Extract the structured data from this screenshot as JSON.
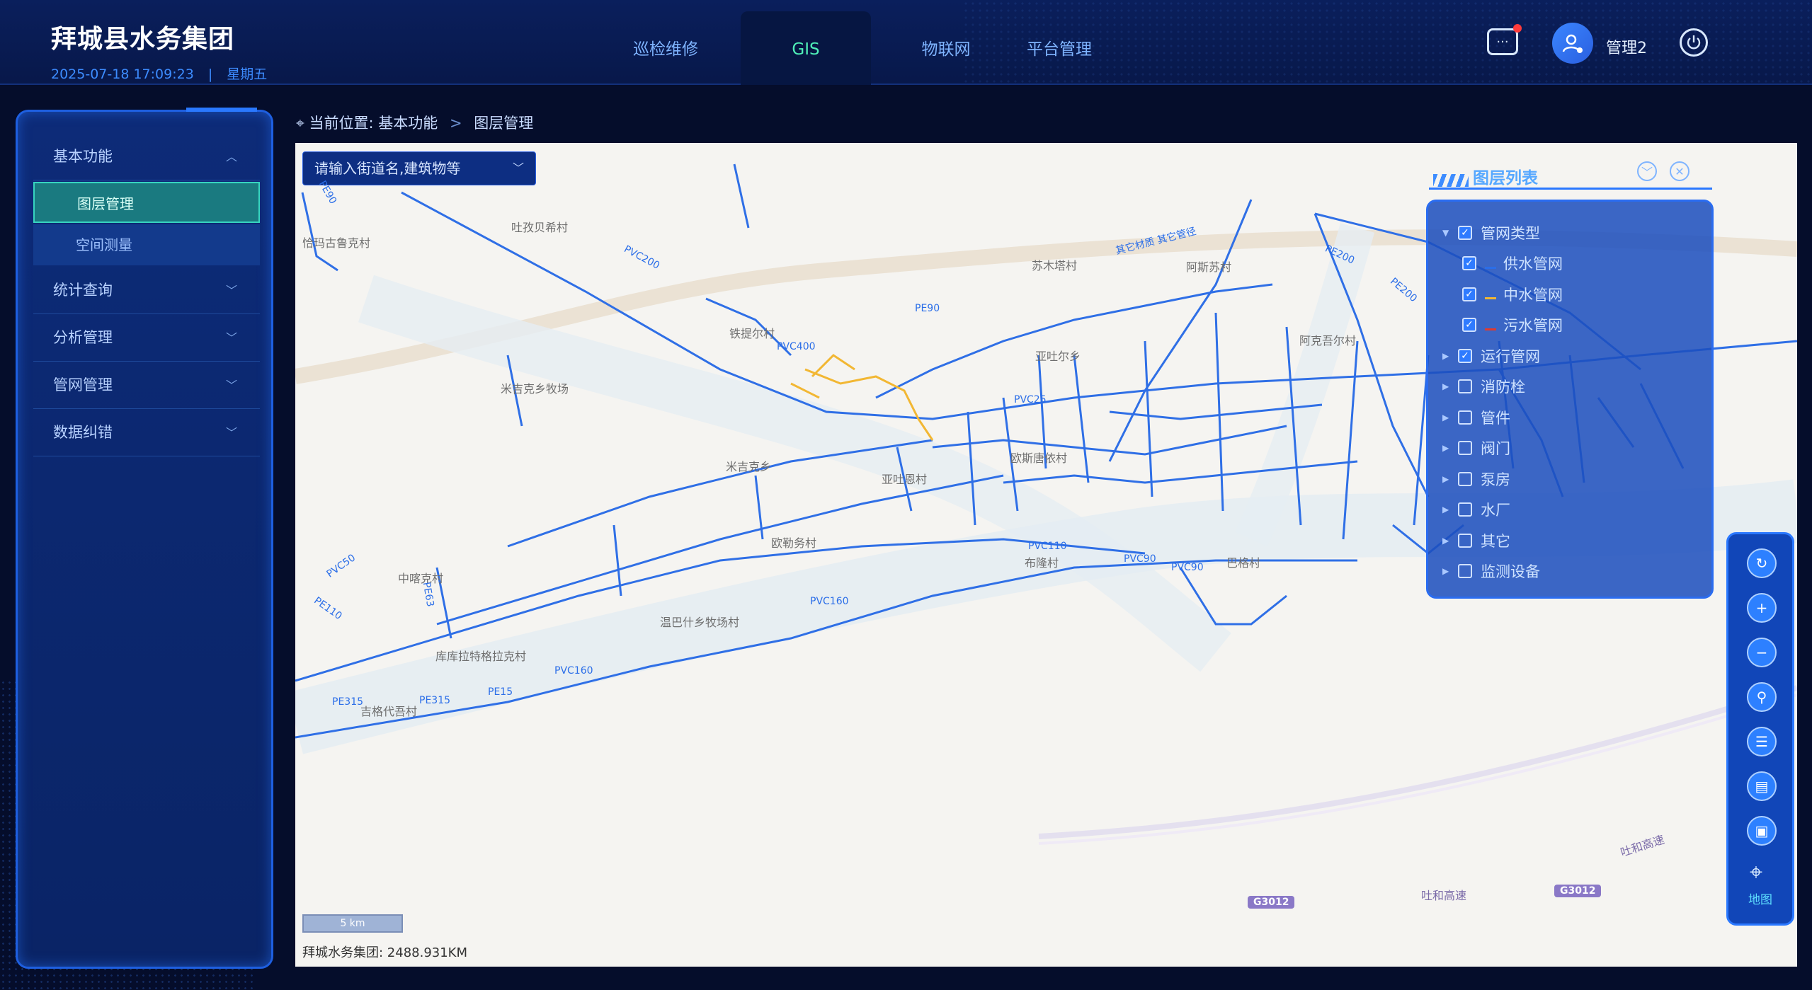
{
  "header": {
    "title": "拜城县水务集团",
    "datetime": "2025-07-18 17:09:23",
    "separator": "|",
    "weekday": "星期五",
    "nav": [
      "巡检维修",
      "GIS",
      "物联网",
      "平台管理"
    ],
    "active_nav": "GIS",
    "message_icon": "chat-bubble-icon",
    "username": "管理2",
    "power_icon": "power-icon"
  },
  "sidebar": {
    "menu": [
      {
        "label": "基本功能",
        "expanded": true,
        "children": [
          "图层管理",
          "空间测量"
        ],
        "active_child": "图层管理"
      },
      {
        "label": "统计查询",
        "expanded": false
      },
      {
        "label": "分析管理",
        "expanded": false
      },
      {
        "label": "管网管理",
        "expanded": false
      },
      {
        "label": "数据纠错",
        "expanded": false
      }
    ]
  },
  "breadcrumb": {
    "prefix": "当前位置:",
    "items": [
      "基本功能",
      "图层管理"
    ]
  },
  "map": {
    "search_placeholder": "请输入街道名,建筑物等",
    "labels": {
      "place_1": "恰玛古鲁克村",
      "place_2": "吐孜贝希村",
      "place_3": "铁提尔村",
      "place_4": "米吉克乡牧场",
      "place_5": "米吉克乡",
      "place_6": "亚吐恩村",
      "place_7": "欧勒务村",
      "place_8": "中喀克村",
      "place_9": "温巴什乡牧场村",
      "place_10": "库库拉特格拉克村",
      "place_11": "吉格代吾村",
      "place_12": "亚吐尔乡",
      "place_13": "欧斯唐依村",
      "place_14": "巴格村",
      "place_15": "阿克吾尔村",
      "place_16": "阿斯苏村",
      "place_17": "布隆村",
      "place_18": "苏木塔村",
      "road_1": "吐和高速",
      "road_2": "吐和高速",
      "shield_1": "G3012",
      "shield_2": "G3012",
      "pipe_1": "PE90",
      "pipe_2": "PVC200",
      "pipe_3": "PE90",
      "pipe_4": "PE200",
      "pipe_5": "PE200",
      "pipe_6": "其它材质 其它管径",
      "pipe_7": "PVC400",
      "pipe_8": "PVC25",
      "pipe_9": "PVC110",
      "pipe_10": "PVC90",
      "pipe_11": "PVC90",
      "pipe_12": "PVC160",
      "pipe_13": "PVC160",
      "pipe_14": "PVC50",
      "pipe_15": "PE110",
      "pipe_16": "PE63",
      "pipe_17": "PE315",
      "pipe_18": "PE315",
      "pipe_19": "PE15"
    },
    "scale_label": "5 km",
    "total_length": "拜城水务集团: 2488.931KM"
  },
  "layer_panel": {
    "title": "图层列表",
    "layers": [
      {
        "label": "管网类型",
        "checked": true,
        "expanded": true,
        "children": [
          {
            "label": "供水管网",
            "checked": true,
            "color": "#2b6ee8"
          },
          {
            "label": "中水管网",
            "checked": true,
            "color": "#f2b733"
          },
          {
            "label": "污水管网",
            "checked": true,
            "color": "#e03a2f"
          }
        ]
      },
      {
        "label": "运行管网",
        "checked": true
      },
      {
        "label": "消防栓",
        "checked": false
      },
      {
        "label": "管件",
        "checked": false
      },
      {
        "label": "阀门",
        "checked": false
      },
      {
        "label": "泵房",
        "checked": false
      },
      {
        "label": "水厂",
        "checked": false
      },
      {
        "label": "其它",
        "checked": false
      },
      {
        "label": "监测设备",
        "checked": false
      }
    ]
  },
  "toolbar": {
    "tools": [
      "refresh-icon",
      "zoom-in-icon",
      "zoom-out-icon",
      "locate-user-icon",
      "sliders-icon",
      "clipboard-icon",
      "image-frame-icon"
    ],
    "map_label": "地图"
  },
  "colors": {
    "accent": "#2a78ff",
    "active_nav": "#4ff0b8",
    "pipe_supply": "#2b6ee8",
    "pipe_reclaimed": "#f2b733",
    "pipe_sewage": "#e03a2f"
  }
}
